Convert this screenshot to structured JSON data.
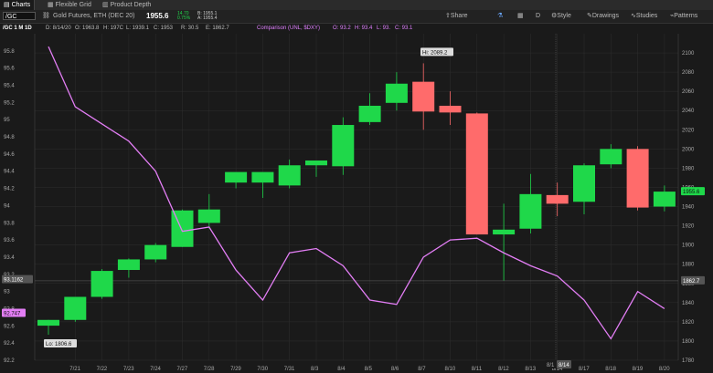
{
  "tabs": [
    {
      "label": "Charts",
      "active": true
    },
    {
      "label": "Flexible Grid",
      "active": false
    },
    {
      "label": "Product Depth",
      "active": false
    }
  ],
  "toolbar": {
    "symbol": "/GC",
    "description": "Gold Futures, ETH (DEC 20)",
    "last": "1955.6",
    "change": "14.70",
    "change_pct": "0.75%",
    "bid": "B: 1955.1",
    "ask": "A: 1955.4",
    "share": "Share",
    "period": "D",
    "style": "Style",
    "drawings": "Drawings",
    "studies": "Studies",
    "patterns": "Patterns"
  },
  "infobar": {
    "label": "/GC 1 M 1D",
    "date": "D: 8/14/20",
    "open": "O: 1963.8",
    "high": "H: 197C",
    "low": "L: 1939.1",
    "close": "C: 1953",
    "range": "R: 30.5",
    "prev": "E: 1862.7",
    "compare_label": "Comparison (UNL, $DXY)",
    "compare_open": "O: 93.2",
    "compare_high": "H: 93.4",
    "compare_low": "L: 93.",
    "compare_close": "C: 93.1"
  },
  "colors": {
    "up": "#1fd84a",
    "down": "#ff6b6b",
    "line": "#e37ef5",
    "grid": "#2e2e2e"
  },
  "chart_data": {
    "type": "candlestick+line",
    "x_labels": [
      "7/21",
      "7/22",
      "7/23",
      "7/24",
      "7/27",
      "7/28",
      "7/29",
      "7/30",
      "7/31",
      "8/3",
      "8/4",
      "8/5",
      "8/6",
      "8/7",
      "8/10",
      "8/11",
      "8/12",
      "8/13",
      "8/14",
      "8/17",
      "8/18",
      "8/19",
      "8/20"
    ],
    "x_labels_extra": [
      "8/1",
      "8/14"
    ],
    "gold": {
      "ylim": [
        1780,
        2120
      ],
      "ticks": [
        1780,
        1800,
        1820,
        1840,
        1860,
        1880,
        1900,
        1920,
        1940,
        1960,
        1980,
        2000,
        2020,
        2040,
        2060,
        2080,
        2100
      ],
      "candles": [
        {
          "o": 1816,
          "h": 1822,
          "l": 1806.6,
          "c": 1822
        },
        {
          "o": 1822,
          "h": 1845,
          "l": 1820,
          "c": 1846
        },
        {
          "o": 1846,
          "h": 1875,
          "l": 1844,
          "c": 1873
        },
        {
          "o": 1874,
          "h": 1886,
          "l": 1866,
          "c": 1885
        },
        {
          "o": 1885,
          "h": 1902,
          "l": 1882,
          "c": 1900
        },
        {
          "o": 1898,
          "h": 1937,
          "l": 1898,
          "c": 1936
        },
        {
          "o": 1923,
          "h": 1953,
          "l": 1917,
          "c": 1937
        },
        {
          "o": 1965,
          "h": 1970,
          "l": 1959,
          "c": 1976
        },
        {
          "o": 1965,
          "h": 1973,
          "l": 1949,
          "c": 1976
        },
        {
          "o": 1962,
          "h": 1989,
          "l": 1959,
          "c": 1983
        },
        {
          "o": 1983,
          "h": 1988,
          "l": 1971,
          "c": 1988
        },
        {
          "o": 1982,
          "h": 2033,
          "l": 1973,
          "c": 2025
        },
        {
          "o": 2028,
          "h": 2058,
          "l": 2025,
          "c": 2045
        },
        {
          "o": 2048,
          "h": 2080,
          "l": 2040,
          "c": 2068
        },
        {
          "o": 2070,
          "h": 2089.2,
          "l": 2020,
          "c": 2039
        },
        {
          "o": 2045,
          "h": 2060,
          "l": 2025,
          "c": 2038
        },
        {
          "o": 2037,
          "h": 2038,
          "l": 1911,
          "c": 1911
        },
        {
          "o": 1911,
          "h": 1943,
          "l": 1863,
          "c": 1916
        },
        {
          "o": 1917,
          "h": 1974,
          "l": 1912,
          "c": 1953
        },
        {
          "o": 1952,
          "h": 1965,
          "l": 1930,
          "c": 1943
        },
        {
          "o": 1945,
          "h": 1985,
          "l": 1932,
          "c": 1983
        },
        {
          "o": 1984,
          "h": 2005,
          "l": 1980,
          "c": 2000
        },
        {
          "o": 2000,
          "h": 2003,
          "l": 1936,
          "c": 1939
        },
        {
          "o": 1940,
          "h": 1962,
          "l": 1935,
          "c": 1955.6
        }
      ],
      "high_label": "Hi: 2089.2",
      "low_label": "Lo: 1806.6",
      "last_label": "1955.6",
      "prev_label": "1862.7"
    },
    "comparison": {
      "name": "$DXY",
      "ylim": [
        92.2,
        96.0
      ],
      "ticks": [
        92.2,
        92.4,
        92.6,
        92.8,
        93,
        93.2,
        93.4,
        93.6,
        93.8,
        94,
        94.2,
        94.4,
        94.6,
        94.8,
        95,
        95.2,
        95.4,
        95.6,
        95.8
      ],
      "values": [
        95.85,
        95.15,
        94.95,
        94.75,
        94.4,
        93.7,
        93.75,
        93.25,
        92.9,
        93.45,
        93.5,
        93.3,
        92.9,
        92.85,
        93.4,
        93.6,
        93.62,
        93.45,
        93.3,
        93.18,
        92.9,
        92.45,
        93.0,
        92.8
      ],
      "current_label": "92.747",
      "prev_label": "93.1162"
    }
  }
}
